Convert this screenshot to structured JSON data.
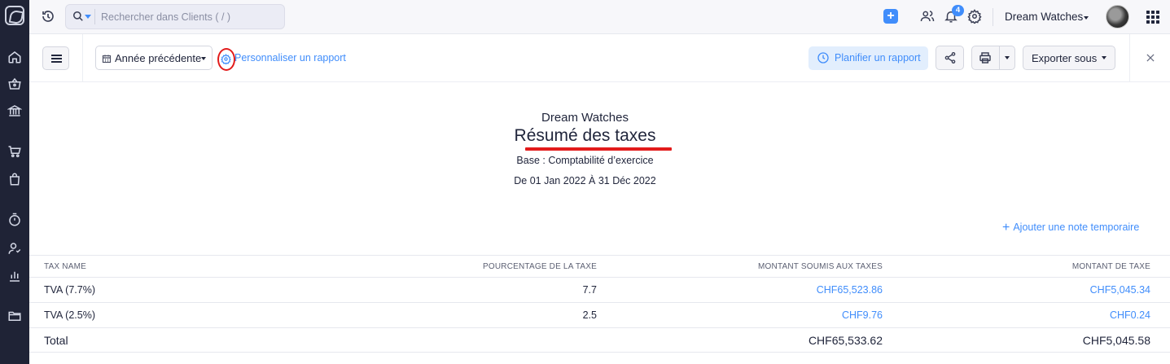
{
  "topbar": {
    "search_placeholder": "Rechercher dans Clients ( / )",
    "notification_count": "4",
    "organization": "Dream Watches"
  },
  "toolbar": {
    "period_label": "Année précédente",
    "customize_label": "Personnaliser un rapport",
    "schedule_label": "Planifier un rapport",
    "export_label": "Exporter sous"
  },
  "report": {
    "company": "Dream Watches",
    "title": "Résumé des taxes",
    "basis": "Base : Comptabilité d’exercice",
    "period": "De 01 Jan 2022 À 31 Déc 2022",
    "add_note": "Ajouter une note temporaire"
  },
  "table": {
    "headers": [
      "TAX NAME",
      "POURCENTAGE DE LA TAXE",
      "MONTANT SOUMIS AUX TAXES",
      "MONTANT DE TAXE"
    ],
    "rows": [
      {
        "name": "TVA (7.7%)",
        "pct": "7.7",
        "taxable": "CHF65,523.86",
        "tax": "CHF5,045.34"
      },
      {
        "name": "TVA (2.5%)",
        "pct": "2.5",
        "taxable": "CHF9.76",
        "tax": "CHF0.24"
      }
    ],
    "total": {
      "label": "Total",
      "taxable": "CHF65,533.62",
      "tax": "CHF5,045.58"
    }
  },
  "colors": {
    "accent": "#408dfb",
    "sidebar": "#1f2336",
    "highlight": "#e21b1b"
  },
  "icons": [
    "home-icon",
    "shopping-basket-icon",
    "bank-icon",
    "cart-icon",
    "bag-icon",
    "timer-icon",
    "user-icon",
    "bar-chart-icon",
    "folder-icon",
    "history-icon",
    "search-icon",
    "add-icon",
    "users-icon",
    "bell-icon",
    "gear-icon",
    "apps-grid-icon",
    "calendar-icon",
    "clock-icon",
    "share-icon",
    "printer-icon",
    "close-icon"
  ]
}
